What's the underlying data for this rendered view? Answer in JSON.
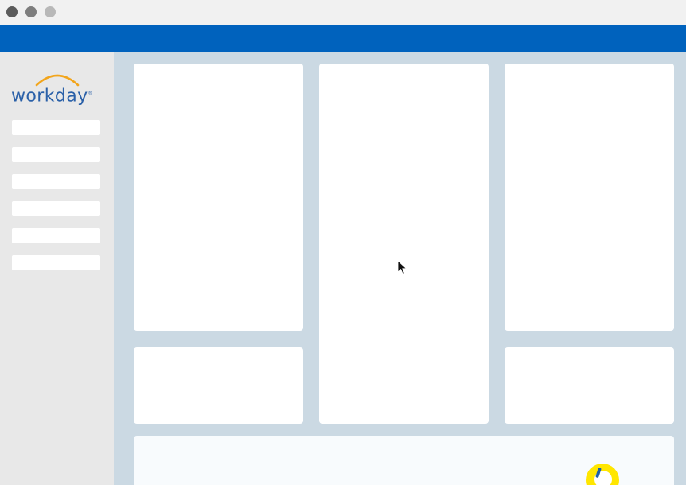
{
  "brand": {
    "name": "workday",
    "registered_mark": "®",
    "text_color": "#2a60a8",
    "arc_color": "#f2a51c"
  },
  "colors": {
    "topbar": "#0062bd",
    "sidebar": "#e8e8e8",
    "content_bg": "#cbd9e3",
    "card": "#ffffff",
    "badge": "#ffe600"
  },
  "window_controls": [
    "close-dot",
    "minimize-dot",
    "maximize-dot"
  ],
  "sidebar": {
    "items": [
      "",
      "",
      "",
      "",
      "",
      ""
    ]
  },
  "icons": {
    "cursor": "mouse-pointer-icon",
    "badge": "assistant-badge-icon"
  }
}
